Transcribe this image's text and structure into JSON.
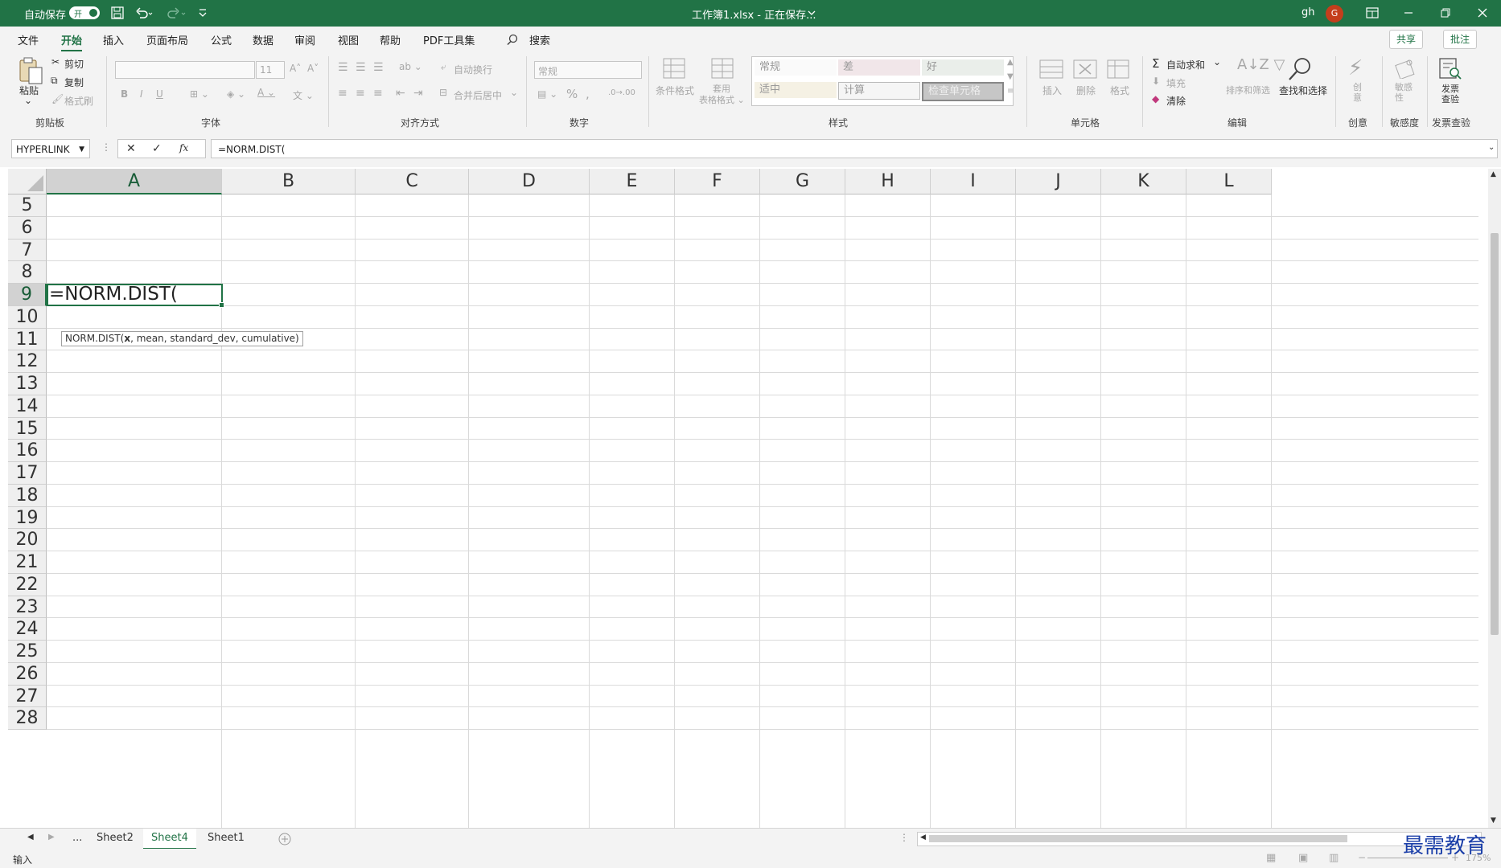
{
  "titlebar": {
    "autosave_label": "自动保存",
    "autosave_state": "开",
    "doc_title": "工作簿1.xlsx - 正在保存...",
    "user": "gh",
    "avatar_initial": "G"
  },
  "ribbon_tabs": [
    "文件",
    "开始",
    "插入",
    "页面布局",
    "公式",
    "数据",
    "审阅",
    "视图",
    "帮助",
    "PDF工具集"
  ],
  "search_label": "搜索",
  "share_label": "共享",
  "comment_label": "批注",
  "ribbon": {
    "clipboard": {
      "paste": "粘贴",
      "cut": "剪切",
      "copy": "复制",
      "format_painter": "格式刷",
      "group": "剪贴板"
    },
    "font": {
      "font_size": "11",
      "bold": "B",
      "italic": "I",
      "underline": "U",
      "group": "字体"
    },
    "alignment": {
      "wrap": "自动换行",
      "merge": "合并后居中",
      "group": "对齐方式"
    },
    "number": {
      "format": "常规",
      "group": "数字"
    },
    "styles": {
      "conditional": "条件格式",
      "table_format": "套用\n表格格式",
      "cells": [
        "常规",
        "差",
        "好",
        "适中",
        "计算",
        "检查单元格"
      ],
      "group": "样式"
    },
    "cells": {
      "insert": "插入",
      "delete": "删除",
      "format": "格式",
      "group": "单元格"
    },
    "editing": {
      "autosum": "自动求和",
      "fill": "填充",
      "clear": "清除",
      "sort": "排序和筛选",
      "find": "查找和选择",
      "group": "编辑"
    },
    "creative": {
      "label": "创\n意",
      "group": "创意"
    },
    "sensitivity": {
      "label": "敏感\n性",
      "group": "敏感度"
    },
    "invoice": {
      "label": "发票\n查验",
      "group": "发票查验"
    }
  },
  "formula_bar": {
    "name_box": "HYPERLINK",
    "formula": "=NORM.DIST("
  },
  "grid": {
    "columns": [
      "A",
      "B",
      "C",
      "D",
      "E",
      "F",
      "G",
      "H",
      "I",
      "J",
      "K",
      "L"
    ],
    "rows": [
      "5",
      "6",
      "7",
      "8",
      "9",
      "10",
      "11",
      "12",
      "13",
      "14",
      "15",
      "16",
      "17",
      "18",
      "19",
      "20",
      "21",
      "22",
      "23",
      "24",
      "25",
      "26",
      "27",
      "28"
    ],
    "active_cell_text": "=NORM.DIST(",
    "tooltip": {
      "func": "NORM.DIST(",
      "arg_current": "x",
      "rest": ", mean, standard_dev, cumulative)"
    }
  },
  "sheets": {
    "more": "...",
    "tabs": [
      "Sheet2",
      "Sheet4",
      "Sheet1"
    ],
    "active": "Sheet4"
  },
  "status": {
    "mode": "输入",
    "zoom": "175%"
  },
  "watermark": "最需教育",
  "colors": {
    "accent": "#217346"
  }
}
